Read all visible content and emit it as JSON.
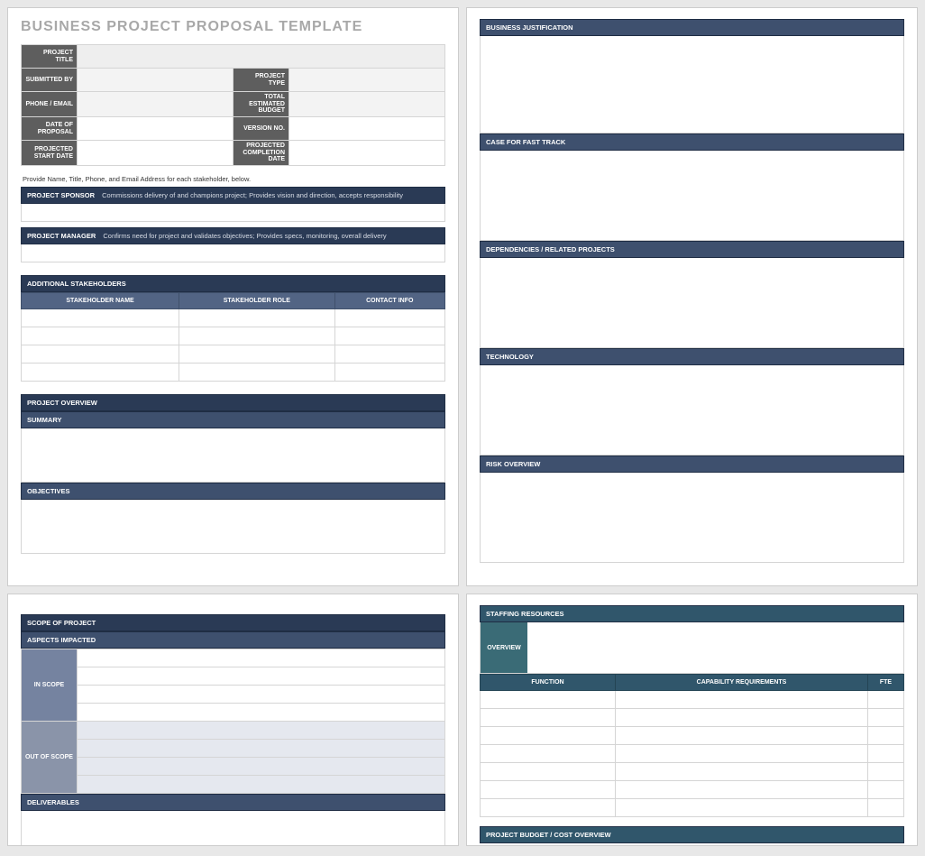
{
  "title": "BUSINESS PROJECT PROPOSAL TEMPLATE",
  "info": {
    "project_title": "PROJECT TITLE",
    "submitted_by": "SUBMITTED BY",
    "project_type": "PROJECT TYPE",
    "phone_email": "PHONE / EMAIL",
    "total_estimated_budget": "TOTAL ESTIMATED BUDGET",
    "date_of_proposal": "DATE OF PROPOSAL",
    "version_no": "VERSION NO.",
    "projected_start_date": "PROJECTED START DATE",
    "projected_completion_date": "PROJECTED COMPLETION DATE"
  },
  "note": "Provide Name, Title, Phone, and Email Address for each stakeholder, below.",
  "sponsor": {
    "label": "PROJECT SPONSOR",
    "desc": "Commissions delivery of and champions project; Provides vision and direction, accepts responsibility"
  },
  "manager": {
    "label": "PROJECT MANAGER",
    "desc": "Confirms need for project and validates objectives; Provides specs, monitoring, overall delivery"
  },
  "stakeholders": {
    "header": "ADDITIONAL STAKEHOLDERS",
    "cols": {
      "name": "STAKEHOLDER NAME",
      "role": "STAKEHOLDER ROLE",
      "contact": "CONTACT INFO"
    }
  },
  "overview": {
    "header": "PROJECT OVERVIEW",
    "summary": "SUMMARY",
    "objectives": "OBJECTIVES"
  },
  "right": {
    "justification": "BUSINESS JUSTIFICATION",
    "fasttrack": "CASE FOR FAST TRACK",
    "dependencies": "DEPENDENCIES / RELATED PROJECTS",
    "technology": "TECHNOLOGY",
    "risk": "RISK OVERVIEW"
  },
  "scope": {
    "header": "SCOPE OF PROJECT",
    "aspects": "ASPECTS IMPACTED",
    "in_scope": "IN SCOPE",
    "out_scope": "OUT OF SCOPE",
    "deliverables": "DELIVERABLES"
  },
  "staff": {
    "header": "STAFFING RESOURCES",
    "overview": "OVERVIEW",
    "cols": {
      "function": "FUNCTION",
      "capability": "CAPABILITY REQUIREMENTS",
      "fte": "FTE"
    },
    "budget": "PROJECT BUDGET / COST OVERVIEW"
  }
}
